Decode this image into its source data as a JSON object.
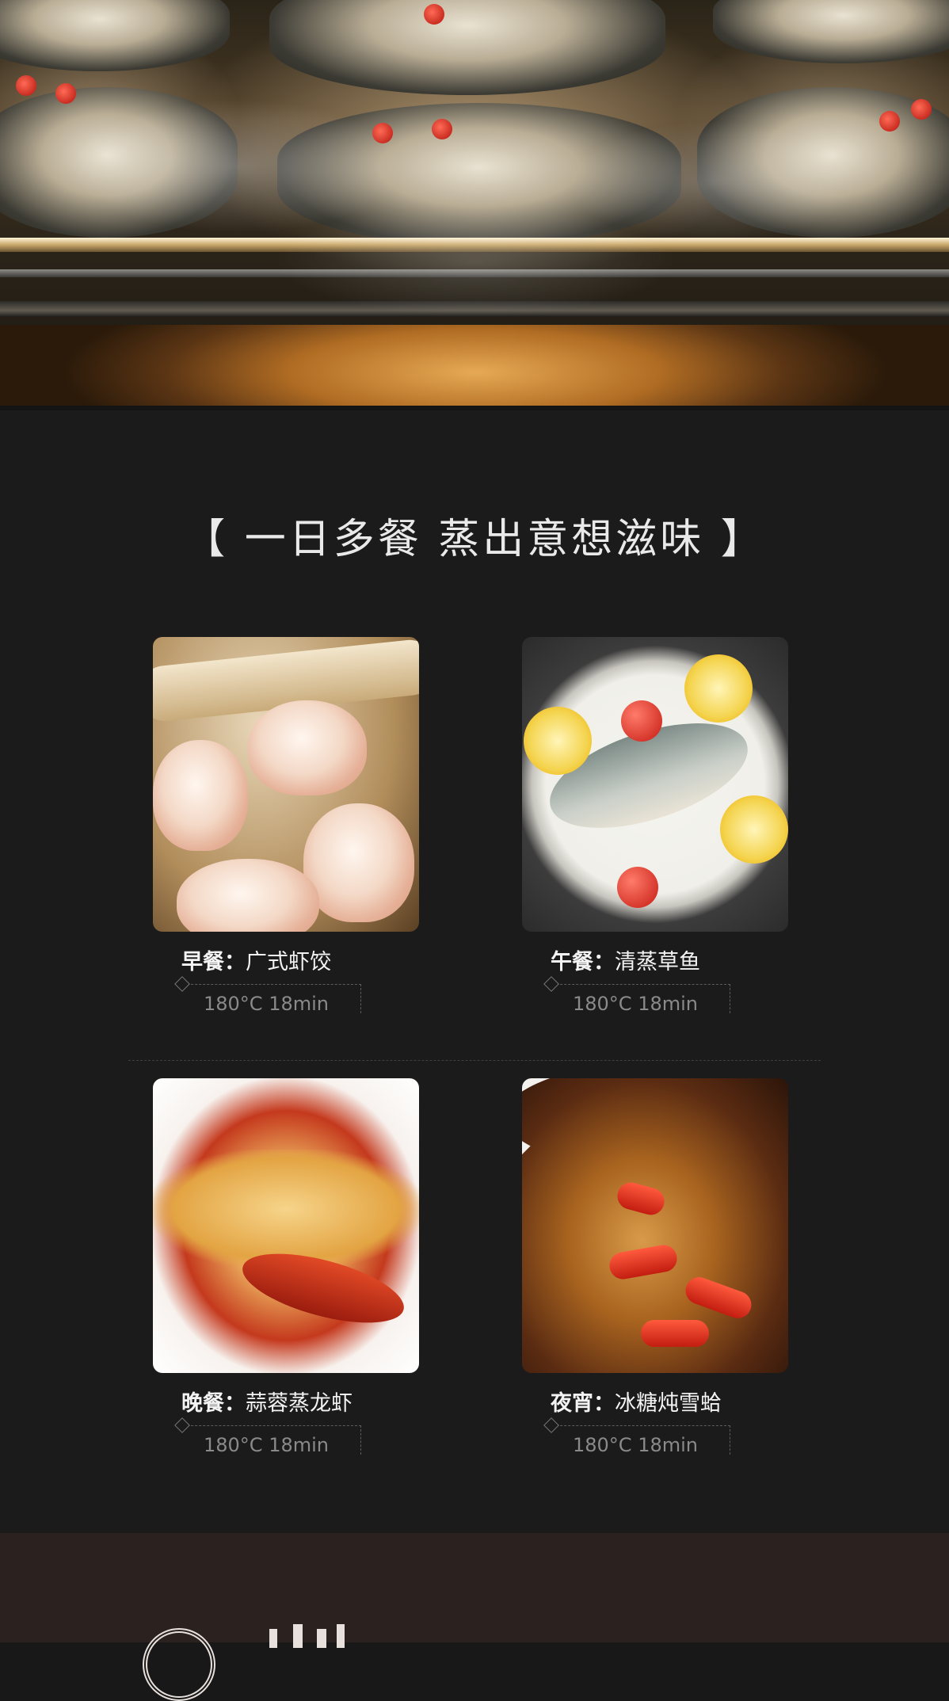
{
  "heading": "【 一日多餐  蒸出意想滋味 】",
  "meals": [
    {
      "label": "早餐：",
      "dish": "广式虾饺",
      "temp": "180°C 18min"
    },
    {
      "label": "午餐：",
      "dish": "清蒸草鱼",
      "temp": "180°C 18min"
    },
    {
      "label": "晚餐：",
      "dish": "蒜蓉蒸龙虾",
      "temp": "180°C 18min"
    },
    {
      "label": "夜宵：",
      "dish": "冰糖炖雪蛤",
      "temp": "180°C 18min"
    }
  ],
  "colors": {
    "background": "#1b1b1b",
    "heading": "#e9e9e9",
    "temp_text": "#8a8a8a",
    "footer": "#2b221f"
  }
}
